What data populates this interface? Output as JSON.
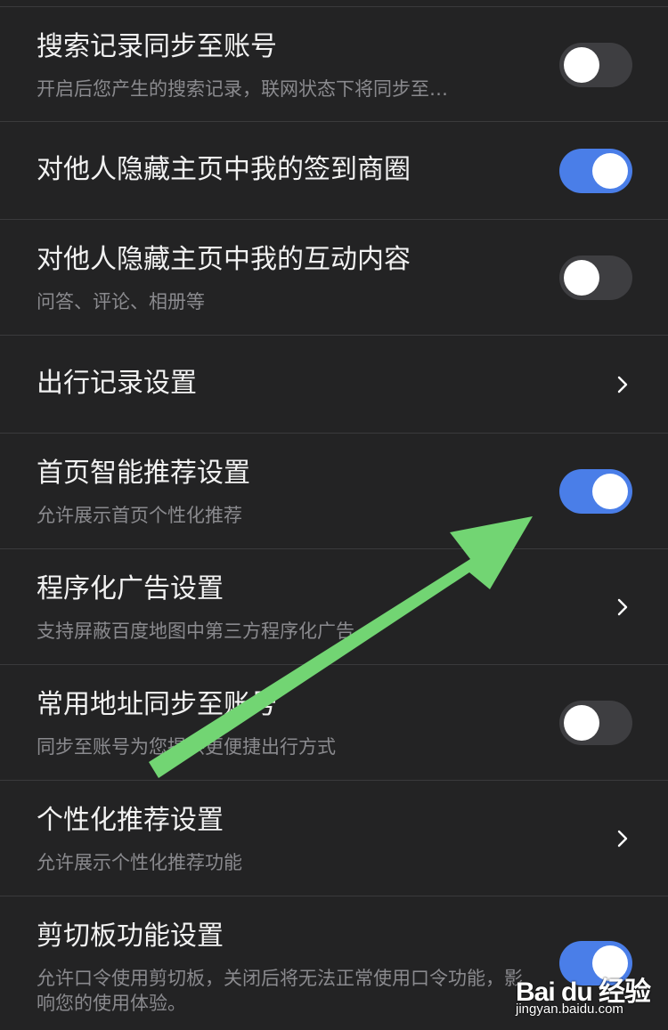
{
  "settings": {
    "items": [
      {
        "title": "搜索记录同步至账号",
        "subtitle": "开启后您产生的搜索记录，联网状态下将同步至…",
        "control": "toggle",
        "state": "off"
      },
      {
        "title": "对他人隐藏主页中我的签到商圈",
        "subtitle": "",
        "control": "toggle",
        "state": "on"
      },
      {
        "title": "对他人隐藏主页中我的互动内容",
        "subtitle": "问答、评论、相册等",
        "control": "toggle",
        "state": "off"
      },
      {
        "title": "出行记录设置",
        "subtitle": "",
        "control": "chevron"
      },
      {
        "title": "首页智能推荐设置",
        "subtitle": "允许展示首页个性化推荐",
        "control": "toggle",
        "state": "on"
      },
      {
        "title": "程序化广告设置",
        "subtitle": "支持屏蔽百度地图中第三方程序化广告",
        "control": "chevron"
      },
      {
        "title": "常用地址同步至账号",
        "subtitle": "同步至账号为您提供更便捷出行方式",
        "control": "toggle",
        "state": "off"
      },
      {
        "title": "个性化推荐设置",
        "subtitle": "允许展示个性化推荐功能",
        "control": "chevron"
      },
      {
        "title": "剪切板功能设置",
        "subtitle": "允许口令使用剪切板，关闭后将无法正常使用口令功能，影响您的使用体验。",
        "control": "toggle",
        "state": "on"
      }
    ]
  },
  "annotation": {
    "arrow_color": "#72d573"
  },
  "watermark": {
    "logo_text": "Bai du 经验",
    "url_text": "jingyan.baidu.com"
  },
  "colors": {
    "background": "#232324",
    "divider": "#3a3a3c",
    "toggle_on": "#4a7ee8",
    "toggle_off": "#3e3e41",
    "title_text": "#f2f2f2",
    "subtitle_text": "#8a8a8e"
  }
}
